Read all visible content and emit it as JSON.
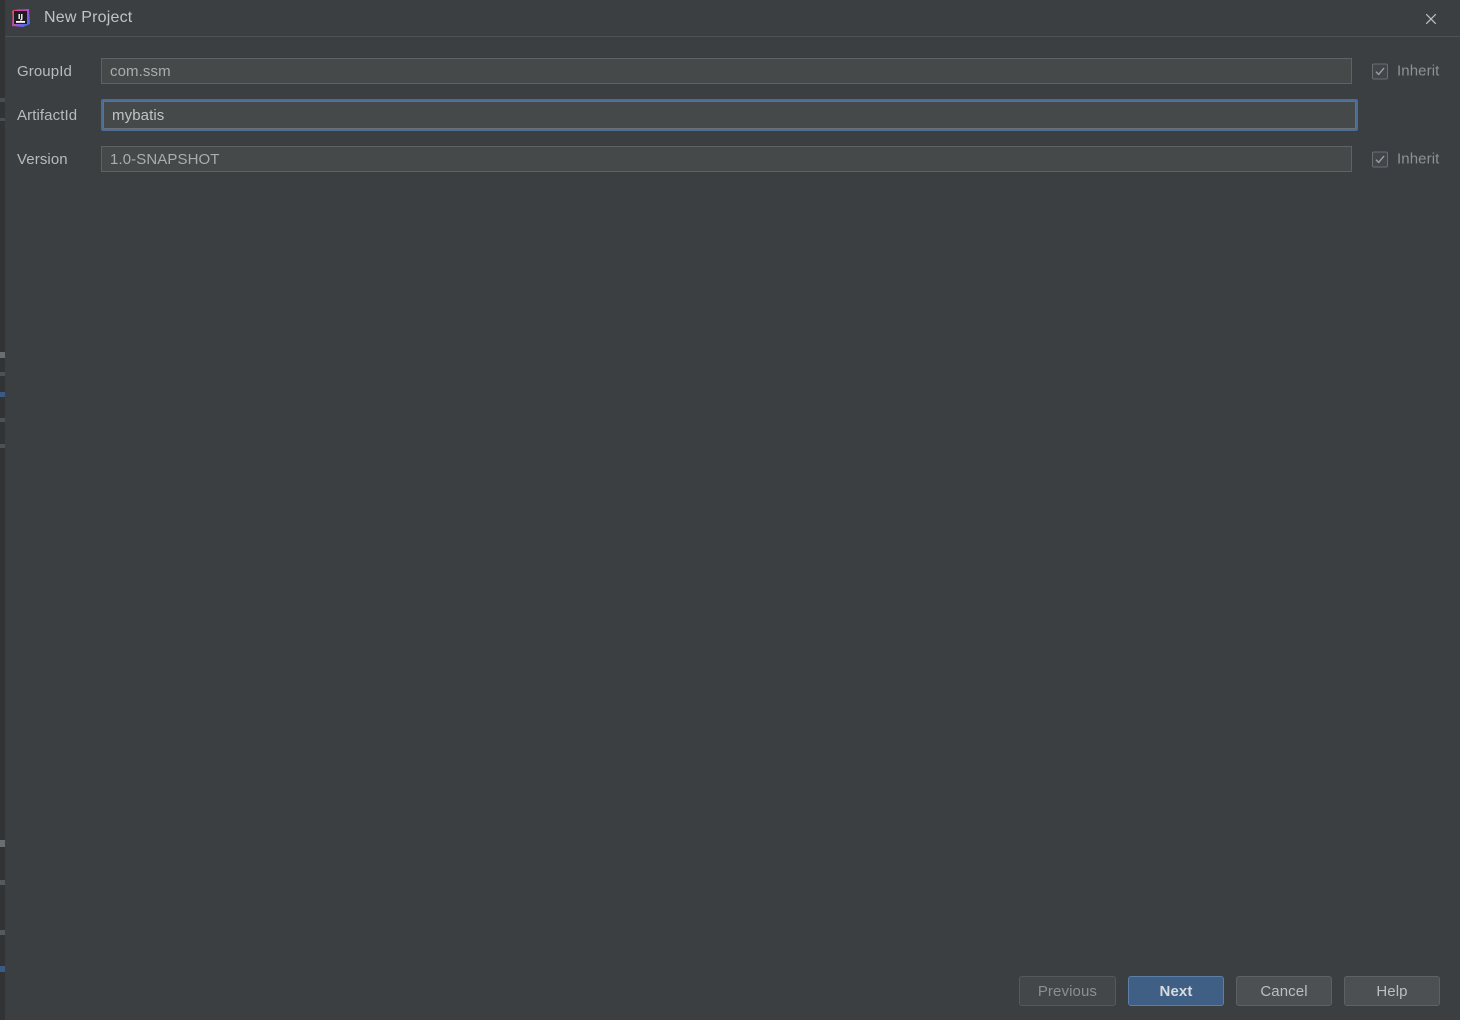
{
  "window": {
    "title": "New Project",
    "app_icon": "intellij-idea-icon",
    "close_icon": "close-icon",
    "background_color": "#3c3f41"
  },
  "form": {
    "rows": [
      {
        "label": "GroupId",
        "value": "com.ssm",
        "placeholder": "",
        "focused": false,
        "inherit": {
          "label": "Inherit",
          "checked": true
        }
      },
      {
        "label": "ArtifactId",
        "value": "mybatis",
        "placeholder": "",
        "focused": true,
        "inherit": null
      },
      {
        "label": "Version",
        "value": "1.0-SNAPSHOT",
        "placeholder": "",
        "focused": false,
        "inherit": {
          "label": "Inherit",
          "checked": true
        }
      }
    ]
  },
  "footer": {
    "previous_label": "Previous",
    "next_label": "Next",
    "cancel_label": "Cancel",
    "help_label": "Help",
    "primary_color": "#3f5f85"
  }
}
